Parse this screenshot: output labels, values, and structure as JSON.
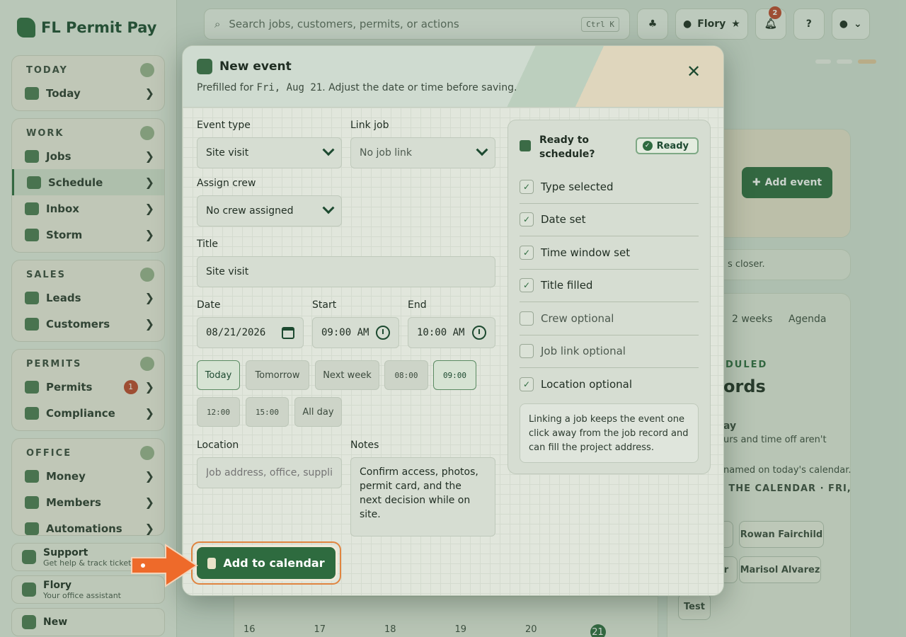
{
  "app": {
    "brand": "FL Permit Pay",
    "search_placeholder": "Search jobs, customers, permits, or actions",
    "search_shortcut": "Ctrl K",
    "user_name": "Flory",
    "notification_count": "2",
    "help_label": "?",
    "nav": [
      {
        "header": "TODAY",
        "items": [
          {
            "label": "Today"
          }
        ]
      },
      {
        "header": "WORK",
        "items": [
          {
            "label": "Jobs"
          },
          {
            "label": "Schedule"
          },
          {
            "label": "Inbox"
          },
          {
            "label": "Storm"
          }
        ]
      },
      {
        "header": "SALES",
        "items": [
          {
            "label": "Leads"
          },
          {
            "label": "Customers"
          }
        ]
      },
      {
        "header": "PERMITS",
        "items": [
          {
            "label": "Permits",
            "count": "1"
          },
          {
            "label": "Compliance"
          }
        ]
      },
      {
        "header": "OFFICE",
        "items": [
          {
            "label": "Money"
          },
          {
            "label": "Members"
          },
          {
            "label": "Automations"
          }
        ]
      }
    ],
    "support_title": "Support",
    "support_sub": "Get help & track tickets",
    "assistant_title": "Flory",
    "assistant_sub": "Your office assistant",
    "new_label": "New",
    "bg_add_event": "Add event",
    "bg_closer_text": "s closer.",
    "bg_tab_2weeks": "2 weeks",
    "bg_tab_agenda": "Agenda",
    "bg_scheduled": "DULED",
    "bg_records": "ords",
    "bg_day_title": "ay",
    "bg_day_line1": "urs and time off aren't",
    "bg_day_line2": "named on today's calendar.",
    "bg_on_calendar": "N THE CALENDAR · FRI,",
    "bg_chip_rowan": "Rowan Fairchild",
    "bg_chip_marisol": "Marisol Alvarez",
    "bg_chip_r": "r",
    "bg_chip_test": "Test",
    "bg_days": [
      "16",
      "17",
      "18",
      "19",
      "20",
      "21"
    ]
  },
  "modal": {
    "title": "New event",
    "subtitle_prefix": "Prefilled for ",
    "subtitle_date": "Fri, Aug 21",
    "subtitle_suffix": ". Adjust the date or time before saving.",
    "close": "✕",
    "event_type_label": "Event type",
    "event_type_value": "Site visit",
    "link_job_label": "Link job",
    "link_job_value": "No job link",
    "assign_crew_label": "Assign crew",
    "assign_crew_value": "No crew assigned",
    "title_label": "Title",
    "title_value": "Site visit",
    "date_label": "Date",
    "date_value": "08/21/2026",
    "start_label": "Start",
    "start_value": "09:00 AM",
    "end_label": "End",
    "end_value": "10:00 AM",
    "quick": [
      "Today",
      "Tomorrow",
      "Next week",
      "08:00",
      "09:00",
      "12:00",
      "15:00",
      "All day"
    ],
    "location_label": "Location",
    "location_placeholder": "Job address, office, supplier",
    "notes_label": "Notes",
    "notes_value": "Confirm access, photos, permit card, and the next decision while on site.",
    "submit": "Add to calendar"
  },
  "readiness": {
    "title": "Ready to schedule?",
    "badge": "Ready",
    "checks": [
      {
        "label": "Type selected",
        "checked": true
      },
      {
        "label": "Date set",
        "checked": true
      },
      {
        "label": "Time window set",
        "checked": true
      },
      {
        "label": "Title filled",
        "checked": true
      },
      {
        "label": "Crew optional",
        "checked": false
      },
      {
        "label": "Job link optional",
        "checked": false
      },
      {
        "label": "Location optional",
        "checked": true
      }
    ],
    "tip": "Linking a job keeps the event one click away from the job record and can fill the project address."
  },
  "colors": {
    "accent": "#2e6b3f",
    "highlight": "#e0843f",
    "badge_red": "#c2472c"
  }
}
